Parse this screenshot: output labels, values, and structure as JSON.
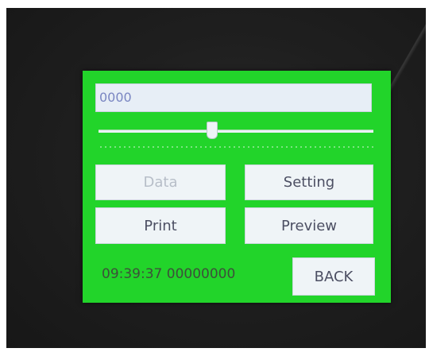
{
  "screen": {
    "value_field": "0000",
    "slider_level": 0.41,
    "buttons": {
      "data_label": "Data",
      "setting_label": "Setting",
      "print_label": "Print",
      "preview_label": "Preview",
      "back_label": "BACK"
    },
    "status_text": "09:39:37 00000000"
  },
  "colors": {
    "screen_green": "#22d42a",
    "button_face": "#eff4f7",
    "field_face": "#e7eef6"
  }
}
